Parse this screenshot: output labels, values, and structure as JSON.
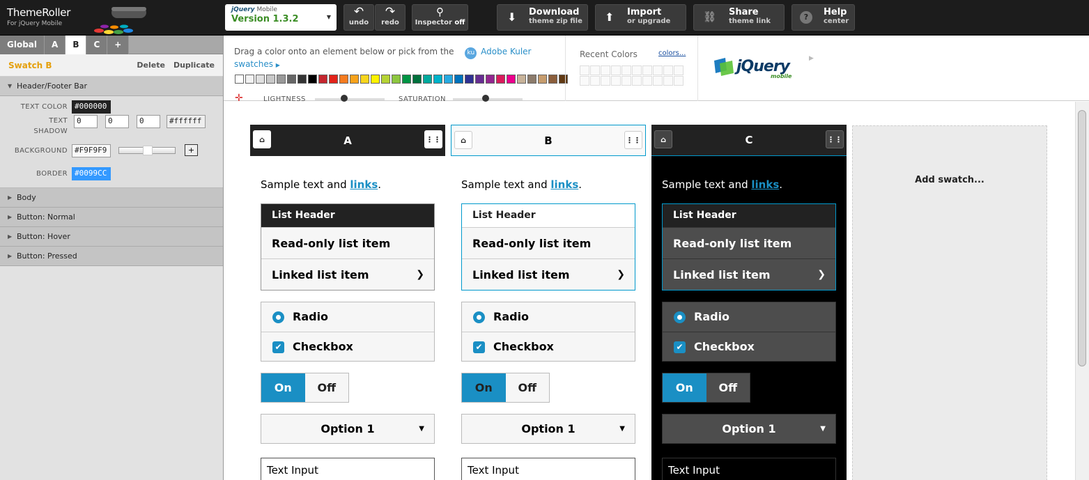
{
  "app": {
    "title": "ThemeRoller",
    "subtitle": "For jQuery Mobile"
  },
  "version": {
    "brand": "jQuery",
    "mobile": "Mobile",
    "label": "Version 1.3.2"
  },
  "toolbar": {
    "undo": "undo",
    "redo": "redo",
    "inspector": "Inspector",
    "inspector_state": "off",
    "download": "Download",
    "download_sub": "theme zip file",
    "import": "Import",
    "import_sub": "or upgrade",
    "share": "Share",
    "share_sub": "theme link",
    "help": "Help",
    "help_sub": "center"
  },
  "sidebar": {
    "tabs": [
      {
        "label": "Global"
      },
      {
        "label": "A"
      },
      {
        "label": "B"
      },
      {
        "label": "C"
      },
      {
        "label": "+"
      }
    ],
    "swatch_title": "Swatch B",
    "delete": "Delete",
    "duplicate": "Duplicate",
    "open_section": "Header/Footer Bar",
    "text_color_label": "TEXT COLOR",
    "text_color": "#000000",
    "text_shadow_label_1": "TEXT",
    "text_shadow_label_2": "SHADOW",
    "shadow_x": "0",
    "shadow_y": "0",
    "shadow_blur": "0",
    "shadow_color": "#ffffff",
    "background_label": "BACKGROUND",
    "background": "#F9F9F9",
    "background_add": "+",
    "border_label": "BORDER",
    "border": "#0099CC",
    "sections": [
      {
        "label": "Body"
      },
      {
        "label": "Button: Normal"
      },
      {
        "label": "Button: Hover"
      },
      {
        "label": "Button: Pressed"
      }
    ]
  },
  "colorbar": {
    "drag_text": "Drag a color onto an element below or pick from the",
    "kuler_badge": "ku",
    "kuler_link": "Adobe Kuler",
    "kuler_link2": "swatches",
    "lightness": "LIGHTNESS",
    "saturation": "SATURATION",
    "recent_label": "Recent Colors",
    "colors_link": "colors...",
    "swatches": [
      "#ffffff",
      "#f2f2f2",
      "#e0e0e0",
      "#c8c8c8",
      "#999999",
      "#666666",
      "#333333",
      "#000000",
      "#c4262e",
      "#e2231a",
      "#f47b20",
      "#f7a21b",
      "#f7d51d",
      "#fef200",
      "#b5d334",
      "#8dc63f",
      "#009444",
      "#00703c",
      "#00a99d",
      "#00b2c9",
      "#27aae1",
      "#0072bc",
      "#2e3192",
      "#662d91",
      "#92278f",
      "#d91c5c",
      "#ec008c",
      "#c7b299",
      "#8c7b6b",
      "#c69c6d",
      "#8b5e3c",
      "#603913"
    ],
    "jq_logo": "jQuery",
    "jq_logo_sub": "mobile"
  },
  "preview": {
    "swatches": [
      {
        "letter": "A",
        "sample": "Sample text and ",
        "link": "links",
        "list_header": "List Header",
        "readonly": "Read-only list item",
        "linked": "Linked list item",
        "radio": "Radio",
        "checkbox": "Checkbox",
        "on": "On",
        "off": "Off",
        "option": "Option 1",
        "text_input": "Text Input"
      },
      {
        "letter": "B",
        "sample": "Sample text and ",
        "link": "links",
        "list_header": "List Header",
        "readonly": "Read-only list item",
        "linked": "Linked list item",
        "radio": "Radio",
        "checkbox": "Checkbox",
        "on": "On",
        "off": "Off",
        "option": "Option 1",
        "text_input": "Text Input"
      },
      {
        "letter": "C",
        "sample": "Sample text and ",
        "link": "links",
        "list_header": "List Header",
        "readonly": "Read-only list item",
        "linked": "Linked list item",
        "radio": "Radio",
        "checkbox": "Checkbox",
        "on": "On",
        "off": "Off",
        "option": "Option 1",
        "text_input": "Text Input"
      }
    ],
    "add_swatch": "Add swatch..."
  },
  "colors": {
    "accent": "#1a8fc4",
    "swatch_title": "#e5a00d"
  }
}
